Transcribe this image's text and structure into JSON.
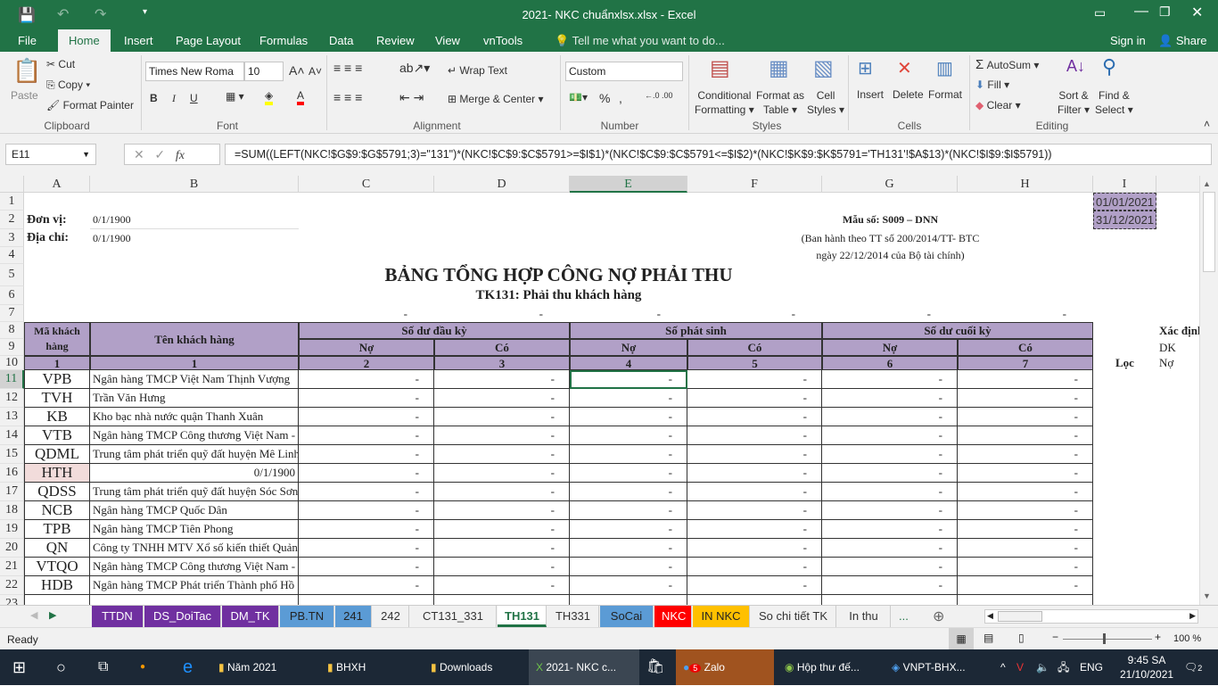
{
  "window": {
    "title": "2021- NKC chuẩnxlsx.xlsx - Excel"
  },
  "menu": {
    "tabs": [
      "File",
      "Home",
      "Insert",
      "Page Layout",
      "Formulas",
      "Data",
      "Review",
      "View",
      "vnTools"
    ],
    "tell_me": "Tell me what you want to do...",
    "sign_in": "Sign in",
    "share": "Share"
  },
  "ribbon": {
    "clipboard": {
      "paste": "Paste",
      "cut": "Cut",
      "copy": "Copy",
      "format_painter": "Format Painter",
      "label": "Clipboard"
    },
    "font": {
      "name": "Times New Roma",
      "size": "10",
      "bold": "B",
      "italic": "I",
      "underline": "U",
      "label": "Font",
      "fill_color": "#ffff00",
      "font_color": "#ff0000"
    },
    "alignment": {
      "wrap": "Wrap Text",
      "merge": "Merge & Center",
      "label": "Alignment"
    },
    "number": {
      "format": "Custom",
      "percent": "%",
      "comma": ",",
      "label": "Number"
    },
    "styles": {
      "conditional": "Conditional",
      "conditional2": "Formatting",
      "format_table": "Format as",
      "format_table2": "Table",
      "cell_styles": "Cell",
      "cell_styles2": "Styles",
      "label": "Styles"
    },
    "cells": {
      "insert": "Insert",
      "delete": "Delete",
      "format": "Format",
      "label": "Cells"
    },
    "editing": {
      "autosum": "AutoSum",
      "fill": "Fill",
      "clear": "Clear",
      "sort": "Sort &",
      "sort2": "Filter",
      "find": "Find &",
      "find2": "Select",
      "label": "Editing"
    }
  },
  "formula_bar": {
    "name_box": "E11",
    "fx": "fx",
    "formula": "=SUM((LEFT(NKC!$G$9:$G$5791;3)=\"131\")*(NKC!$C$9:$C$5791>=$I$1)*(NKC!$C$9:$C$5791<=$I$2)*(NKC!$K$9:$K$5791='TH131'!$A$13)*(NKC!$I$9:$I$5791))"
  },
  "columns": [
    "A",
    "B",
    "C",
    "D",
    "E",
    "F",
    "G",
    "H",
    "I"
  ],
  "sheet": {
    "don_vi_label": "Đơn vị:",
    "don_vi_value": "0/1/1900",
    "dia_chi_label": "Địa chỉ:",
    "dia_chi_value": "0/1/1900",
    "mau_so": "Mẫu số: S009 – DNN",
    "ban_hanh": "(Ban hành theo TT số 200/2014/TT- BTC",
    "ngay": "ngày 22/12/2014 của Bộ tài chính)",
    "title": "BẢNG TỔNG HỢP CÔNG NỢ PHẢI THU",
    "subtitle": "TK131: Phải thu khách hàng",
    "row7_values": [
      "-",
      "-",
      "-",
      "-",
      "-",
      "-"
    ],
    "date_from": "01/01/2021",
    "date_to": "31/12/2021",
    "header": {
      "ma_kh": "Mã khách hàng",
      "ten_kh": "Tên khách hàng",
      "so_du_dau": "Số dư đầu kỳ",
      "phat_sinh": "Số phát sinh",
      "so_du_cuoi": "Số dư cuối kỳ",
      "no": "Nợ",
      "co": "Có",
      "nums": [
        "1",
        "1",
        "2",
        "3",
        "4",
        "5",
        "6",
        "7"
      ],
      "loc": "Lọc",
      "xac_dinh": "Xác định",
      "dk": "DK",
      "no_j": "Nợ"
    },
    "rows": [
      {
        "ma": "VPB",
        "ten": "Ngân hàng TMCP Việt Nam Thịnh Vượng",
        "vals": [
          "-",
          "-",
          "-",
          "-",
          "-",
          "-"
        ]
      },
      {
        "ma": "TVH",
        "ten": "Trần Văn Hưng",
        "vals": [
          "-",
          "-",
          "-",
          "-",
          "-",
          "-"
        ]
      },
      {
        "ma": "KB",
        "ten": "Kho bạc nhà nước quận Thanh Xuân",
        "vals": [
          "-",
          "-",
          "-",
          "-",
          "-",
          "-"
        ]
      },
      {
        "ma": "VTB",
        "ten": "Ngân hàng TMCP Công thương Việt Nam -",
        "vals": [
          "-",
          "-",
          "-",
          "-",
          "-",
          "-"
        ]
      },
      {
        "ma": "QDML",
        "ten": "Trung tâm phát triển quỹ đất huyện Mê Linh",
        "vals": [
          "-",
          "-",
          "-",
          "-",
          "-",
          "-"
        ]
      },
      {
        "ma": "HTH",
        "ten": "0/1/1900",
        "vals": [
          "-",
          "-",
          "-",
          "-",
          "-",
          "-"
        ],
        "highlight": true
      },
      {
        "ma": "QDSS",
        "ten": "Trung tâm phát triển quỹ đất huyện Sóc Sơn",
        "vals": [
          "-",
          "-",
          "-",
          "-",
          "-",
          "-"
        ]
      },
      {
        "ma": "NCB",
        "ten": "Ngân hàng TMCP Quốc Dân",
        "vals": [
          "-",
          "-",
          "-",
          "-",
          "-",
          "-"
        ]
      },
      {
        "ma": "TPB",
        "ten": "Ngân hàng TMCP Tiên Phong",
        "vals": [
          "-",
          "-",
          "-",
          "-",
          "-",
          "-"
        ]
      },
      {
        "ma": "QN",
        "ten": "Công ty TNHH MTV Xổ số kiến thiết Quảng Ninh",
        "vals": [
          "-",
          "-",
          "-",
          "-",
          "-",
          "-"
        ]
      },
      {
        "ma": "VTQO",
        "ten": "Ngân hàng TMCP Công thương Việt Nam -",
        "vals": [
          "-",
          "-",
          "-",
          "-",
          "-",
          "-"
        ]
      },
      {
        "ma": "HDB",
        "ten": "Ngân hàng TMCP Phát triển Thành phố Hồ",
        "vals": [
          "-",
          "-",
          "-",
          "-",
          "-",
          "-"
        ]
      }
    ]
  },
  "sheet_tabs": [
    {
      "label": "TTDN",
      "color": "#7030a0"
    },
    {
      "label": "DS_DoiTac",
      "color": "#7030a0"
    },
    {
      "label": "DM_TK",
      "color": "#7030a0"
    },
    {
      "label": "PB.TN",
      "color": "#5b9bd5"
    },
    {
      "label": "241",
      "color": "#5b9bd5"
    },
    {
      "label": "242",
      "color": ""
    },
    {
      "label": "CT131_331",
      "color": ""
    },
    {
      "label": "TH131",
      "color": "",
      "active": true
    },
    {
      "label": "TH331",
      "color": ""
    },
    {
      "label": "SoCai",
      "color": "#5b9bd5"
    },
    {
      "label": "NKC",
      "color": "#ff0000"
    },
    {
      "label": "IN NKC",
      "color": "#ffc000"
    },
    {
      "label": "So chi tiết TK",
      "color": ""
    },
    {
      "label": "In thu",
      "color": ""
    }
  ],
  "status": {
    "ready": "Ready",
    "zoom": "100 %"
  },
  "taskbar": {
    "items": [
      "Năm 2021",
      "BHXH",
      "Downloads",
      "2021- NKC c...",
      "Zalo",
      "Hộp thư đế...",
      "VNPT-BHX..."
    ],
    "zalo_badge": "5",
    "lang": "ENG",
    "time": "9:45 SA",
    "date": "21/10/2021",
    "notif": "2"
  }
}
